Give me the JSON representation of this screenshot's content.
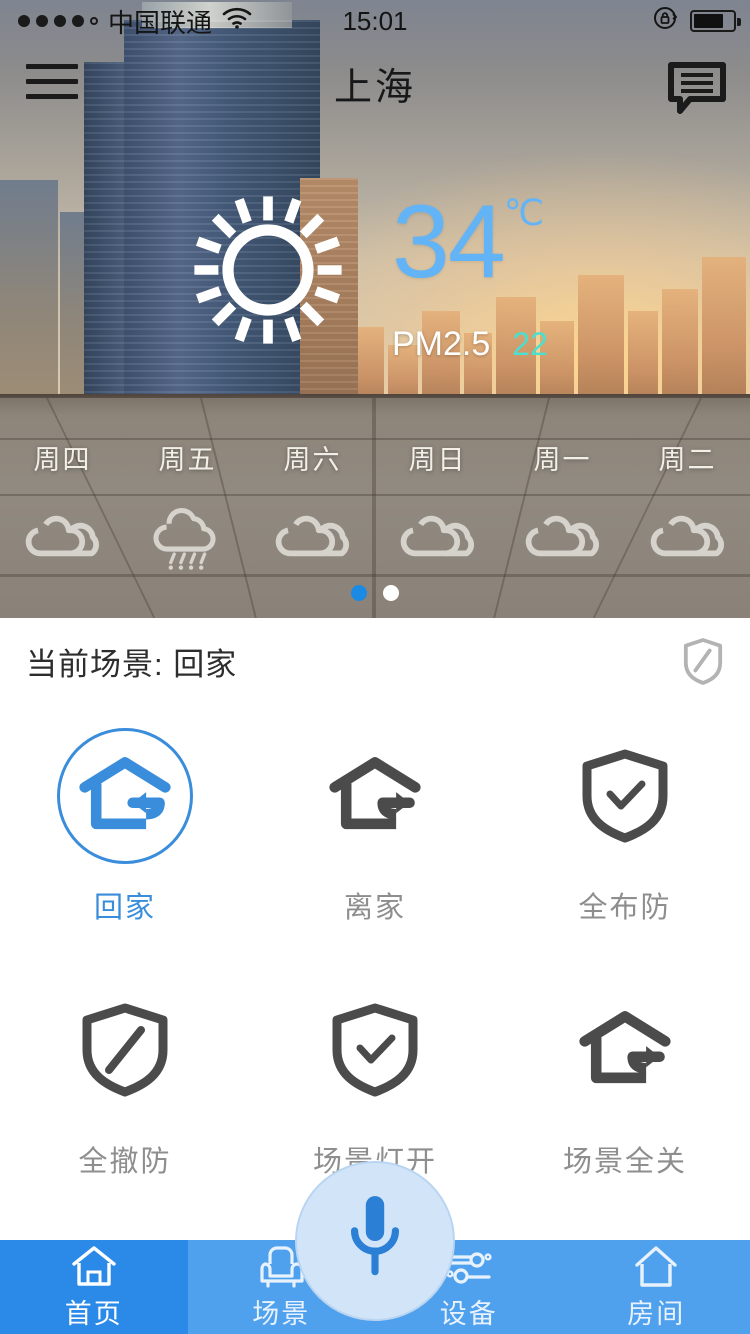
{
  "status_bar": {
    "signal_dots_filled": 4,
    "signal_dots_total": 5,
    "carrier": "中国联通",
    "wifi_icon": "wifi-icon",
    "time": "15:01",
    "rotation_lock_icon": "rotation-lock-icon",
    "battery_icon": "battery-icon",
    "battery_level_percent": 75
  },
  "top_nav": {
    "menu_icon": "hamburger-menu-icon",
    "title": "上海",
    "message_icon": "message-bubble-icon"
  },
  "weather": {
    "condition_icon": "sun-icon",
    "temperature": "34",
    "temperature_unit": "℃",
    "pm_label": "PM2.5",
    "pm_value": "22",
    "temp_color": "#63b4f7",
    "pm_value_color": "#49e0d0",
    "forecast": [
      {
        "day": "周四",
        "icon": "cloudy-icon"
      },
      {
        "day": "周五",
        "icon": "rain-icon"
      },
      {
        "day": "周六",
        "icon": "cloudy-icon"
      },
      {
        "day": "周日",
        "icon": "cloudy-icon"
      },
      {
        "day": "周一",
        "icon": "cloudy-icon"
      },
      {
        "day": "周二",
        "icon": "cloudy-icon"
      }
    ],
    "pager": {
      "total": 2,
      "active_index": 0,
      "active_color": "#1a8ae5",
      "inactive_color": "#ffffff"
    }
  },
  "scene_panel": {
    "current_scene_text": "当前场景: 回家",
    "security_status_icon": "shield-slash-icon",
    "accent_color": "#3a8ddb",
    "inactive_color": "#8e8e8e",
    "scenes": [
      {
        "label": "回家",
        "icon": "house-arrow-in-icon",
        "active": true
      },
      {
        "label": "离家",
        "icon": "house-arrow-out-icon",
        "active": false
      },
      {
        "label": "全布防",
        "icon": "shield-check-icon",
        "active": false
      },
      {
        "label": "全撤防",
        "icon": "shield-slash-icon",
        "active": false
      },
      {
        "label": "场景灯开",
        "icon": "shield-check-icon",
        "active": false
      },
      {
        "label": "场景全关",
        "icon": "house-arrow-out-icon",
        "active": false
      }
    ]
  },
  "voice_button": {
    "icon": "microphone-icon",
    "color": "#2b7fd4",
    "background": "#d2e4f8"
  },
  "tab_bar": {
    "active_color": "#2b8ae8",
    "background": "#4fa0ed",
    "tabs": [
      {
        "label": "首页",
        "icon": "home-icon",
        "active": true
      },
      {
        "label": "场景",
        "icon": "armchair-icon",
        "active": false
      },
      {
        "label": "设备",
        "icon": "sliders-icon",
        "active": false
      },
      {
        "label": "房间",
        "icon": "room-house-icon",
        "active": false
      }
    ]
  }
}
